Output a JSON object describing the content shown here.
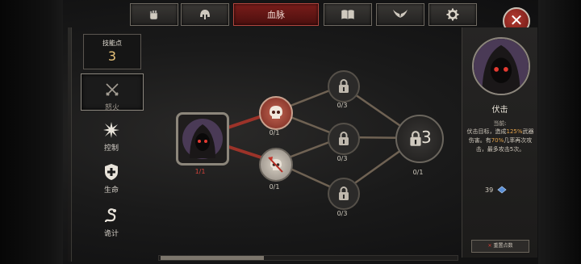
{
  "tabs": [
    {
      "name": "tab-fist",
      "icon": "fist-icon",
      "label": ""
    },
    {
      "name": "tab-helmet",
      "icon": "helmet-icon",
      "label": ""
    },
    {
      "name": "tab-bloodline",
      "icon": "",
      "label": "血脉",
      "active": true
    },
    {
      "name": "tab-book",
      "icon": "book-icon",
      "label": ""
    },
    {
      "name": "tab-wings",
      "icon": "wings-icon",
      "label": ""
    },
    {
      "name": "tab-settings",
      "icon": "gear-icon",
      "label": ""
    }
  ],
  "close_icon": "✕",
  "skill_points": {
    "label": "技能点",
    "value": "3"
  },
  "categories": [
    {
      "label": "怒火",
      "icon": "crossed-swords-icon",
      "active": true
    },
    {
      "label": "控制",
      "icon": "starburst-icon"
    },
    {
      "label": "生命",
      "icon": "shield-cross-icon"
    },
    {
      "label": "诡计",
      "icon": "serpent-icon"
    }
  ],
  "tree": {
    "nodes": {
      "root": {
        "label": "1/1",
        "icon": "hooded-figure-icon"
      },
      "skull_red": {
        "label": "0/1",
        "icon": "skull-icon"
      },
      "skull_axe": {
        "label": "0/1",
        "icon": "skull-axe-icon"
      },
      "lock1": {
        "label": "0/3",
        "icon": "lock-icon"
      },
      "lock2": {
        "label": "0/3",
        "icon": "lock-icon"
      },
      "lock3": {
        "label": "0/3",
        "icon": "lock-icon"
      },
      "lock_big": {
        "label": "0/1",
        "icon": "lock-icon",
        "badge": "3"
      }
    }
  },
  "detail": {
    "title": "伏击",
    "current_label": "当前:",
    "desc_parts": [
      "伏击目标，造成",
      "125%",
      "武器伤害。有",
      "70%",
      "几率再次攻击，最多攻击5次。"
    ],
    "cost": "39",
    "cost_icon": "blue-gem-icon",
    "reset_label": "重置点数",
    "reset_icon": "✕"
  },
  "colors": {
    "accent_red": "#b43b32",
    "highlight": "#e3a24a",
    "active_link": "#a8372f"
  }
}
